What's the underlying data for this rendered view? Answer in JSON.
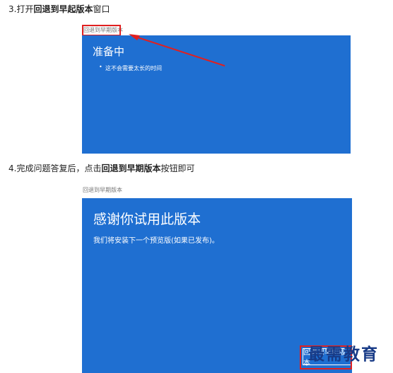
{
  "step3": {
    "prefix": "3.打开",
    "bold": "回退到早起版本",
    "suffix": "窗口"
  },
  "screen1": {
    "caption": "回退到早期版本",
    "title": "准备中",
    "bullet": "•",
    "line": "这不会需要太长的时间"
  },
  "step4": {
    "prefix": "4.完成问题答复后，点击",
    "bold": "回退到早期版本",
    "suffix": "按钮即可"
  },
  "screen2": {
    "caption": "回退到早期版本",
    "title": "感谢你试用此版本",
    "line": "我们将安装下一个预览版(如果已发布)。",
    "button_label": "回退到早期版本"
  },
  "watermark": "最需教育",
  "colors": {
    "screen_blue": "#1f6fd1",
    "highlight_red": "#e02020"
  }
}
